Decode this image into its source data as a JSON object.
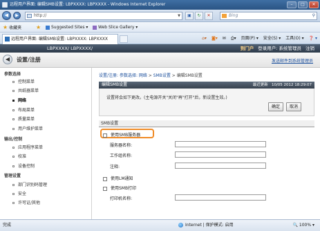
{
  "browser": {
    "window_title": "远程用户界面: 编辑SMB设置: LBPXXXX: LBPXXXX - Windows Internet Explorer",
    "address": "http://",
    "search_placeholder": "Bing",
    "favorites_label": "收藏夹",
    "suggested_sites": "Suggested Sites ▾",
    "web_slice": "Web Slice Gallery ▾",
    "tab_title": "远程用户界面: 编辑SMB设置: LBPXXXX: LBPXXXX",
    "cmd": {
      "page": "页面(P) ▾",
      "safety": "安全(S) ▾",
      "tools": "工具(O) ▾",
      "help": "❓ ▾"
    }
  },
  "header": {
    "model": "LBPXXXX/ LBPXXXX/",
    "portal": "到门户",
    "login_user": "登录用户: 系统管理员",
    "logout": "注销"
  },
  "subheader": {
    "title": "设置/注册",
    "mail_link": "发送邮件到系统管理员"
  },
  "sidebar": {
    "sections": [
      {
        "title": "参数选择",
        "items": [
          "控制菜单",
          "共纸器菜单",
          "网络",
          "布局菜单",
          "质量菜单",
          "用户维护菜单"
        ]
      },
      {
        "title": "输出/控制",
        "items": [
          "应用程序菜单",
          "校准",
          "设备控制"
        ]
      },
      {
        "title": "管理设置",
        "items": [
          "部门识别码管理",
          "安全",
          "许可证/其他"
        ]
      }
    ]
  },
  "breadcrumb": {
    "part1": "设置/注册: 参数选择: 网络",
    "sep1": " > ",
    "part2": "SMB设置",
    "sep2": " > ",
    "part3": "编辑SMB设置"
  },
  "panel": {
    "title": "编辑SMB设置",
    "update_label": "最近更新",
    "timestamp": "10/05 2012 18:29:07",
    "notice": "设置将会如下更改。(主电源开关\"关闭\"再\"打开\"后，新设置生效。)",
    "ok": "确定",
    "cancel": "取消"
  },
  "form": {
    "section": "SMB设置",
    "use_smb_server": "使用SMB服务器",
    "server_name": "服务器名称:",
    "workgroup": "工作组名称:",
    "comment": "注释:",
    "use_lm": "使用LM通知",
    "use_smb_print": "使用SMB打印",
    "printer_name": "打印机名称:"
  },
  "status": {
    "done": "完成",
    "zone": "Internet | 保护模式: 启用",
    "zoom": "🔍 100% ▾"
  }
}
